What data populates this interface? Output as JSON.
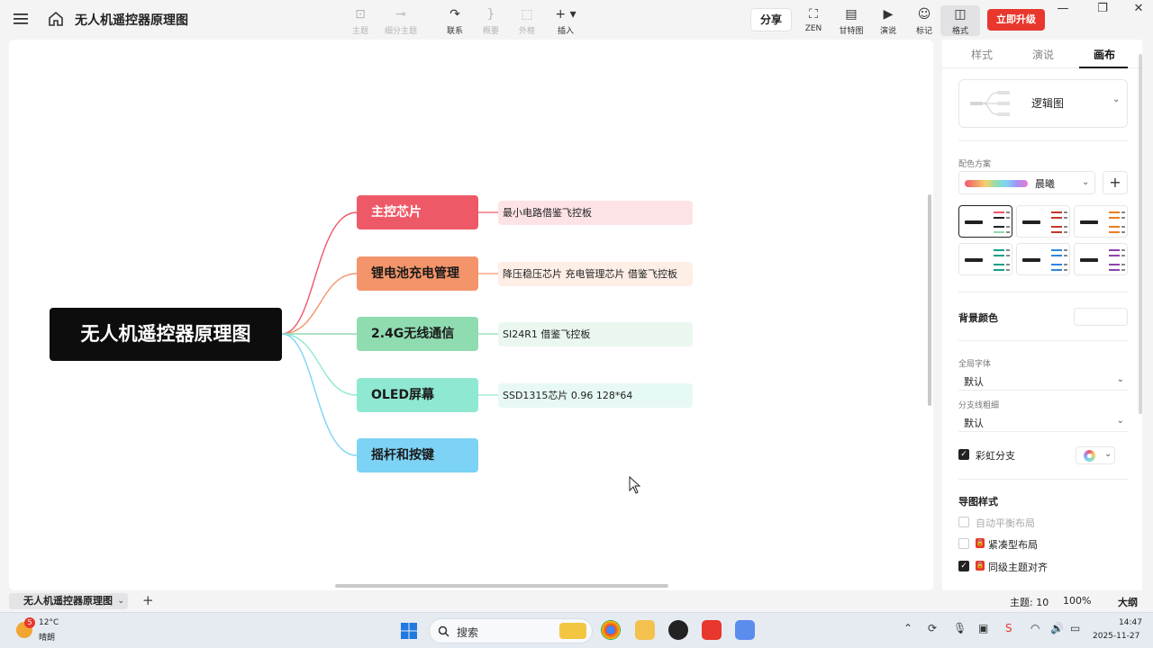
{
  "app": {
    "doc_title": "无人机遥控器原理图"
  },
  "toolbar": {
    "tools": [
      {
        "icon": "topic-icon",
        "label": "主题",
        "enabled": false
      },
      {
        "icon": "subtopic-icon",
        "label": "细分主题",
        "enabled": false
      },
      {
        "icon": "relationship-icon",
        "label": "联系",
        "enabled": true
      },
      {
        "icon": "summary-icon",
        "label": "概要",
        "enabled": false
      },
      {
        "icon": "boundary-icon",
        "label": "外框",
        "enabled": false
      },
      {
        "icon": "insert-icon",
        "label": "插入",
        "enabled": true
      }
    ],
    "share_label": "分享",
    "right_tools": [
      {
        "icon": "zen-icon",
        "label": "ZEN"
      },
      {
        "icon": "gantt-icon",
        "label": "甘特图"
      },
      {
        "icon": "presentation-icon",
        "label": "演说"
      },
      {
        "icon": "marker-icon",
        "label": "标记"
      },
      {
        "icon": "format-icon",
        "label": "格式"
      }
    ],
    "upgrade_label": "立即升级"
  },
  "mindmap": {
    "root": "无人机遥控器原理图",
    "branches": [
      {
        "label": "主控芯片",
        "color": "#ee5968",
        "child": "最小电路借鉴飞控板"
      },
      {
        "label": "锂电池充电管理",
        "color": "#f3946a",
        "child": "降压稳压芯片  充电管理芯片 借鉴飞控板"
      },
      {
        "label": "2.4G无线通信",
        "color": "#8fdcb0",
        "child": "SI24R1  借鉴飞控板"
      },
      {
        "label": "OLED屏幕",
        "color": "#8fe8d2",
        "child": "SSD1315芯片  0.96  128*64"
      },
      {
        "label": "摇杆和按键",
        "color": "#7dd3f5",
        "child": ""
      }
    ]
  },
  "panel": {
    "tabs": [
      "样式",
      "演说",
      "画布"
    ],
    "active_tab": "画布",
    "structure": "逻辑图",
    "color_scheme_label": "配色方案",
    "color_scheme_value": "晨曦",
    "background_label": "背景颜色",
    "font_label": "全局字体",
    "font_value": "默认",
    "branch_width_label": "分支线粗细",
    "branch_width_value": "默认",
    "rainbow_label": "彩虹分支",
    "map_style_label": "导图样式",
    "auto_balance_label": "自动平衡布局",
    "compact_label": "紧凑型布局",
    "align_label": "同级主题对齐"
  },
  "sheetbar": {
    "sheet_name": "无人机遥控器原理图",
    "topics_count": "主题: 10",
    "zoom": "100%",
    "outline": "大纲"
  },
  "taskbar": {
    "weather_badge": "5",
    "temperature": "12°C",
    "weather": "晴朗",
    "search_label": "搜索",
    "time": "14:47",
    "date": "2025-11-27"
  }
}
